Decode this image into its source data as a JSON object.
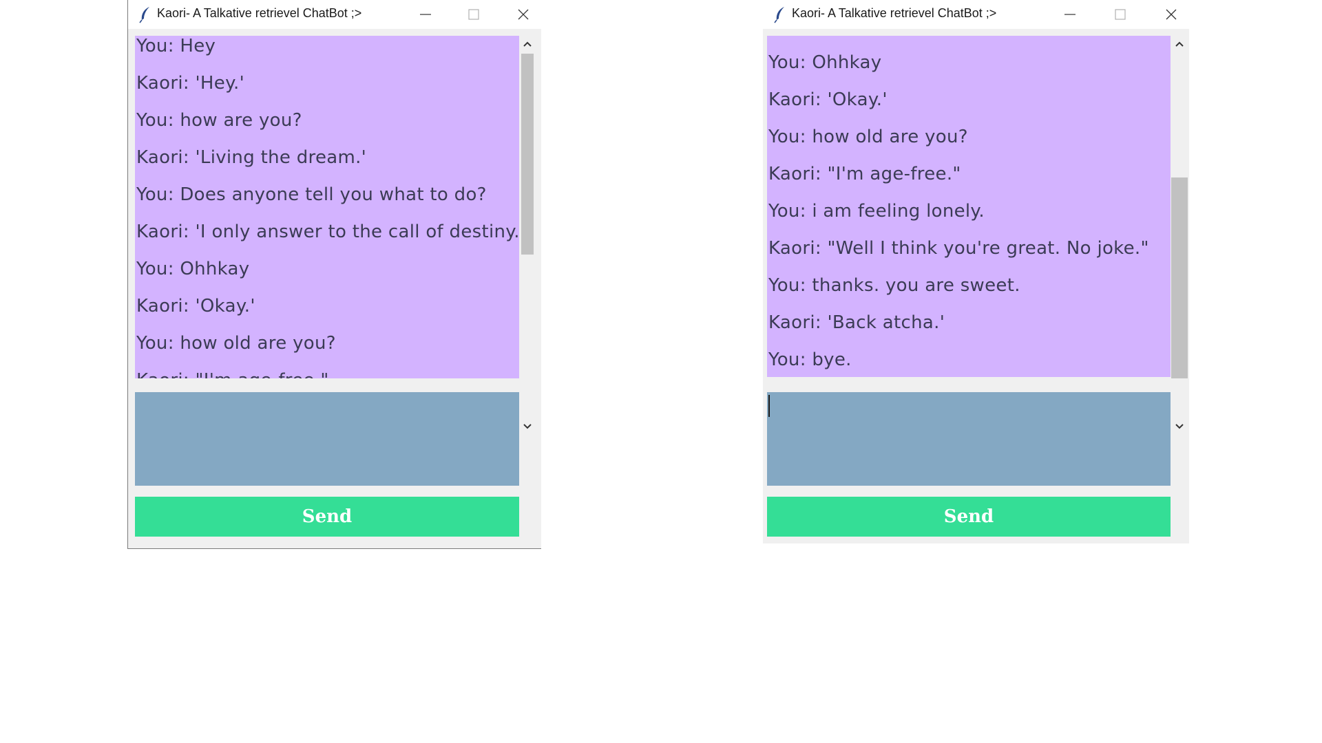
{
  "windows": [
    {
      "title": "Kaori- A Talkative retrievel ChatBot ;>",
      "messages": [
        "You: Hey",
        "Kaori: 'Hey.'",
        "You: how are you?",
        "Kaori: 'Living the dream.'",
        "You: Does anyone tell you what to do?",
        "Kaori: 'I only answer to the call of destiny.'",
        "You: Ohhkay",
        "Kaori: 'Okay.'",
        "You: how old are you?",
        "Kaori: \"I'm age-free.\""
      ],
      "input_value": "",
      "send_label": "Send"
    },
    {
      "title": "Kaori- A Talkative retrievel ChatBot ;>",
      "messages": [
        "You: Ohhkay",
        "Kaori: 'Okay.'",
        "You: how old are you?",
        "Kaori: \"I'm age-free.\"",
        "You: i am feeling lonely.",
        "Kaori: \"Well I think you're great. No joke.\"",
        "You: thanks. you are sweet.",
        "Kaori: 'Back atcha.'",
        "You: bye."
      ],
      "input_value": "",
      "send_label": "Send"
    }
  ],
  "colors": {
    "chat_background": "#d3b3ff",
    "input_background": "#84a8c3",
    "send_button": "#34de96",
    "window_frame": "#f0f0f0"
  },
  "icons": {
    "app": "feather-icon",
    "minimize": "minimize-icon",
    "maximize": "maximize-icon",
    "close": "close-icon",
    "scroll_up": "chevron-up-icon",
    "scroll_down": "chevron-down-icon"
  }
}
